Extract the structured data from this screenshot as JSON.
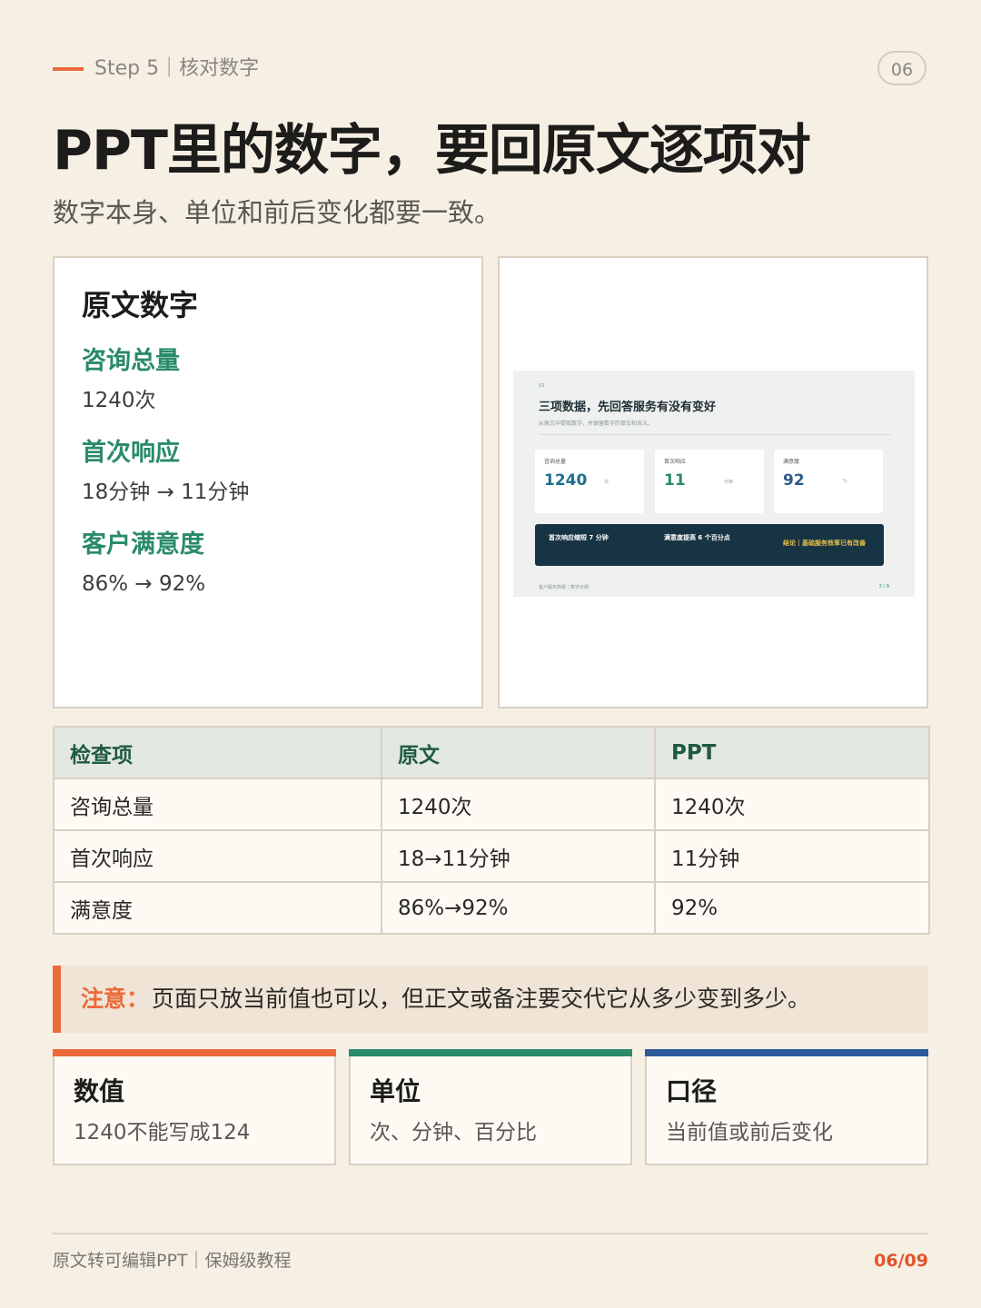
{
  "header": {
    "step": "Step 5｜核对数字",
    "page_badge": "06",
    "title": "PPT里的数字，要回原文逐项对",
    "subtitle": "数字本身、单位和前后变化都要一致。"
  },
  "source_card": {
    "title": "原文数字",
    "metrics": [
      {
        "label": "咨询总量",
        "value": "1240次"
      },
      {
        "label": "首次响应",
        "value": "18分钟 → 11分钟"
      },
      {
        "label": "客户满意度",
        "value": "86% → 92%"
      }
    ]
  },
  "slide_preview": {
    "number": "02",
    "title": "三项数据，先回答服务有没有变好",
    "subtitle": "从原文中提取数字，并保留数字的单位和含义。",
    "cards": [
      {
        "label": "咨询总量",
        "value": "1240",
        "unit": "次",
        "color": "#1f6f8b"
      },
      {
        "label": "首次响应",
        "value": "11",
        "unit": "分钟",
        "color": "#2a8a6a"
      },
      {
        "label": "满意度",
        "value": "92",
        "unit": "%",
        "color": "#2c5a8a"
      }
    ],
    "bar": {
      "item1": "首次响应缩短 7 分钟",
      "item2": "满意度提高 6 个百分点",
      "conclusion": "结论｜基础服务效率已有改善"
    },
    "footer": "客户服务简报｜数字示例",
    "page": "2 / 9"
  },
  "table": {
    "headers": [
      "检查项",
      "原文",
      "PPT"
    ],
    "rows": [
      [
        "咨询总量",
        "1240次",
        "1240次"
      ],
      [
        "首次响应",
        "18→11分钟",
        "11分钟"
      ],
      [
        "满意度",
        "86%→92%",
        "92%"
      ]
    ]
  },
  "note": {
    "label": "注意：",
    "text": "页面只放当前值也可以，但正文或备注要交代它从多少变到多少。"
  },
  "tips": [
    {
      "title": "数值",
      "desc": "1240不能写成124",
      "color": "#ec6a3a"
    },
    {
      "title": "单位",
      "desc": "次、分钟、百分比",
      "color": "#2a8a6a"
    },
    {
      "title": "口径",
      "desc": "当前值或前后变化",
      "color": "#2c5a9a"
    }
  ],
  "footer": {
    "text": "原文转可编辑PPT｜保姆级教程",
    "page": "06/09"
  }
}
